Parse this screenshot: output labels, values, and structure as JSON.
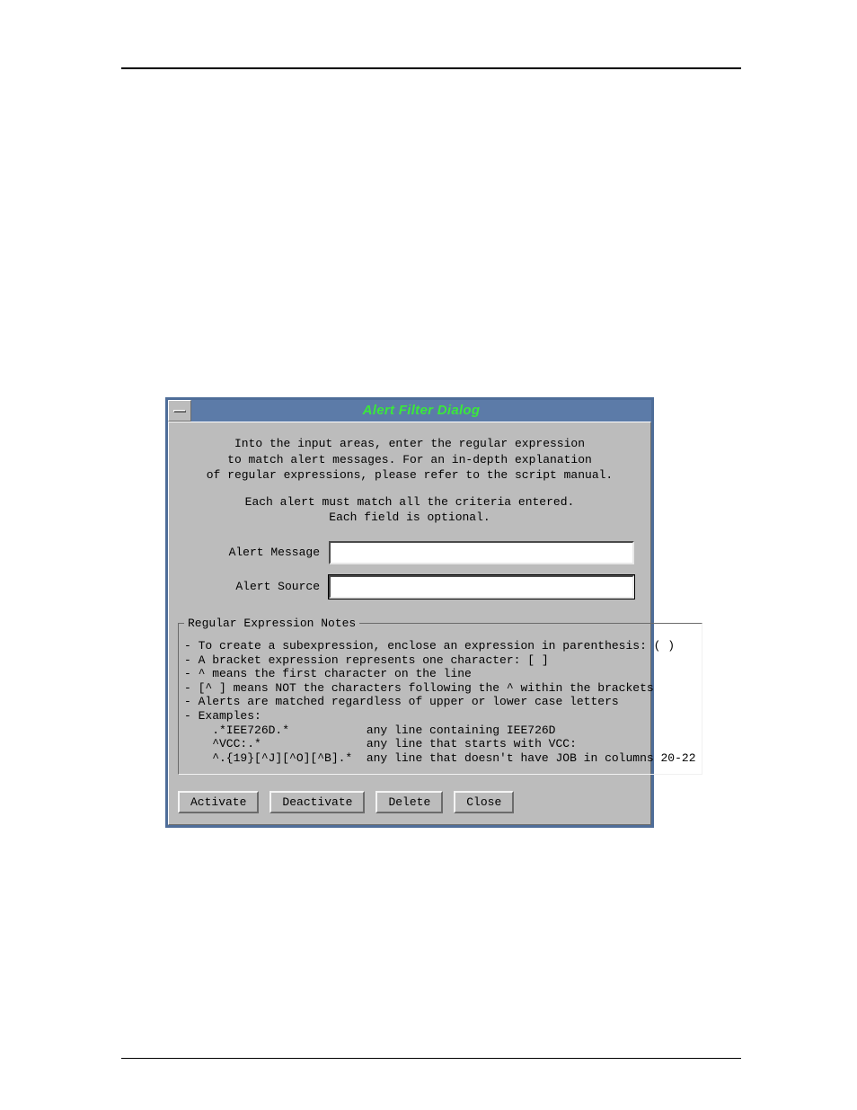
{
  "dialog": {
    "title": "Alert Filter Dialog",
    "intro": {
      "lines": [
        "Into the input areas, enter the regular expression",
        "to match alert messages. For an in-depth explanation",
        "of regular expressions, please refer to the script manual."
      ],
      "note1": "Each alert must match all the criteria entered.",
      "note2": "Each field is optional."
    },
    "fields": {
      "message_label": "Alert Message",
      "message_value": "",
      "source_label": "Alert Source",
      "source_value": ""
    },
    "notes_legend": "Regular Expression Notes",
    "notes_body": "- To create a subexpression, enclose an expression in parenthesis: ( )\n- A bracket expression represents one character: [ ]\n- ^ means the first character on the line\n- [^ ] means NOT the characters following the ^ within the brackets\n- Alerts are matched regardless of upper or lower case letters\n- Examples:\n    .*IEE726D.*           any line containing IEE726D\n    ^VCC:.*               any line that starts with VCC:\n    ^.{19}[^J][^O][^B].*  any line that doesn't have JOB in columns 20-22",
    "buttons": {
      "activate": "Activate",
      "deactivate": "Deactivate",
      "delete": "Delete",
      "close": "Close"
    }
  }
}
